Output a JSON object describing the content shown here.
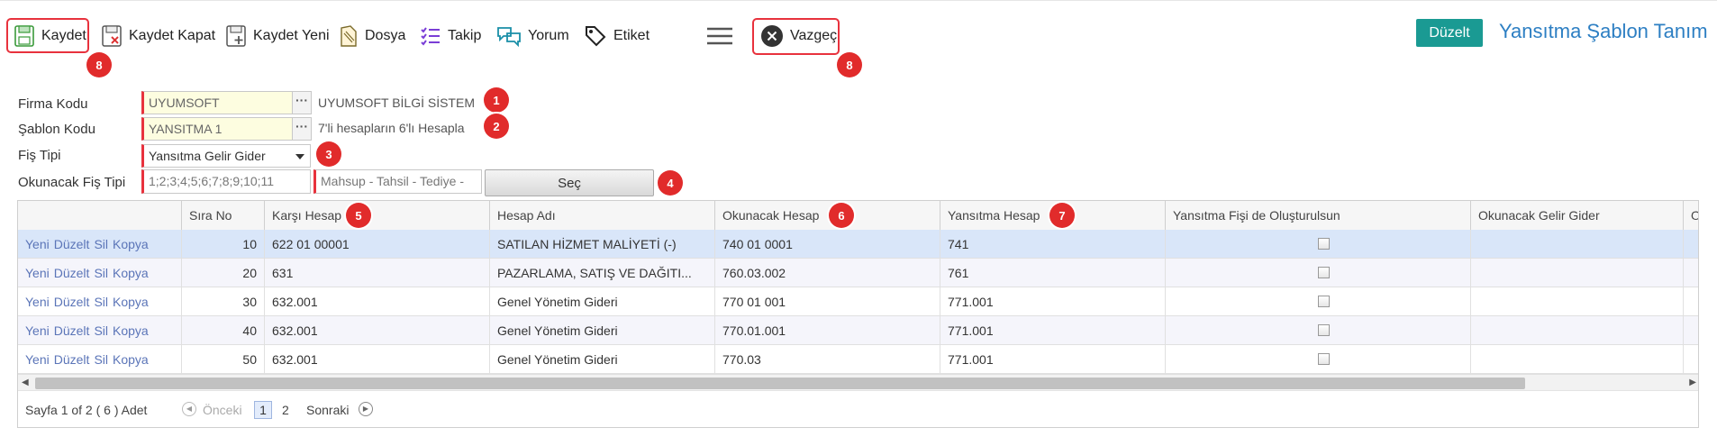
{
  "toolbar": {
    "items": [
      {
        "label": "Kaydet",
        "icon": "save-icon"
      },
      {
        "label": "Kaydet Kapat",
        "icon": "save-close-icon"
      },
      {
        "label": "Kaydet Yeni",
        "icon": "save-new-icon"
      },
      {
        "label": "Dosya",
        "icon": "file-icon"
      },
      {
        "label": "Takip",
        "icon": "checklist-icon"
      },
      {
        "label": "Yorum",
        "icon": "comment-icon"
      },
      {
        "label": "Etiket",
        "icon": "tag-icon"
      }
    ],
    "menu_icon": "hamburger-menu-icon",
    "cancel_label": "Vazgeç",
    "cancel_icon": "close-icon",
    "edit_label": "Düzelt"
  },
  "page_title": "Yansıtma Şablon Tanım",
  "badges": [
    "8",
    "8",
    "1",
    "2",
    "3",
    "4",
    "5",
    "6",
    "7"
  ],
  "form": {
    "firma_kodu": {
      "label": "Firma Kodu",
      "value": "UYUMSOFT",
      "description": "UYUMSOFT BİLGİ SİSTEM"
    },
    "sablon_kodu": {
      "label": "Şablon Kodu",
      "value": "YANSITMA 1",
      "description": "7'li hesapların 6'lı Hesapla"
    },
    "fis_tipi": {
      "label": "Fiş Tipi",
      "value": "Yansıtma Gelir Gider"
    },
    "okunacak_fis_tipi": {
      "label": "Okunacak Fiş Tipi",
      "value": "1;2;3;4;5;6;7;8;9;10;11",
      "names": "Mahsup - Tahsil - Tediye -",
      "button": "Seç"
    }
  },
  "grid": {
    "columns": [
      "",
      "Sıra No",
      "Karşı Hesap",
      "Hesap Adı",
      "Okunacak Hesap",
      "Yansıtma Hesap",
      "Yansıtma Fişi de Oluşturulsun",
      "Okunacak Gelir Gider",
      "O"
    ],
    "row_actions": [
      "Yeni",
      "Düzelt",
      "Sil",
      "Kopya"
    ],
    "rows": [
      {
        "sira": "10",
        "karsi": "622 01 00001",
        "adi": "SATILAN HİZMET MALİYETİ (-)",
        "okunacak": "740 01 0001",
        "yansitma": "741"
      },
      {
        "sira": "20",
        "karsi": "631",
        "adi": "PAZARLAMA, SATIŞ VE DAĞITI...",
        "okunacak": "760.03.002",
        "yansitma": "761"
      },
      {
        "sira": "30",
        "karsi": "632.001",
        "adi": "Genel Yönetim Gideri",
        "okunacak": "770 01 001",
        "yansitma": "771.001"
      },
      {
        "sira": "40",
        "karsi": "632.001",
        "adi": "Genel Yönetim Gideri",
        "okunacak": "770.01.001",
        "yansitma": "771.001"
      },
      {
        "sira": "50",
        "karsi": "632.001",
        "adi": "Genel Yönetim Gideri",
        "okunacak": "770.03",
        "yansitma": "771.001"
      }
    ]
  },
  "pager": {
    "summary": "Sayfa 1 of 2 ( 6 ) Adet",
    "prev": "Önceki",
    "page1": "1",
    "page2": "2",
    "next": "Sonraki"
  }
}
